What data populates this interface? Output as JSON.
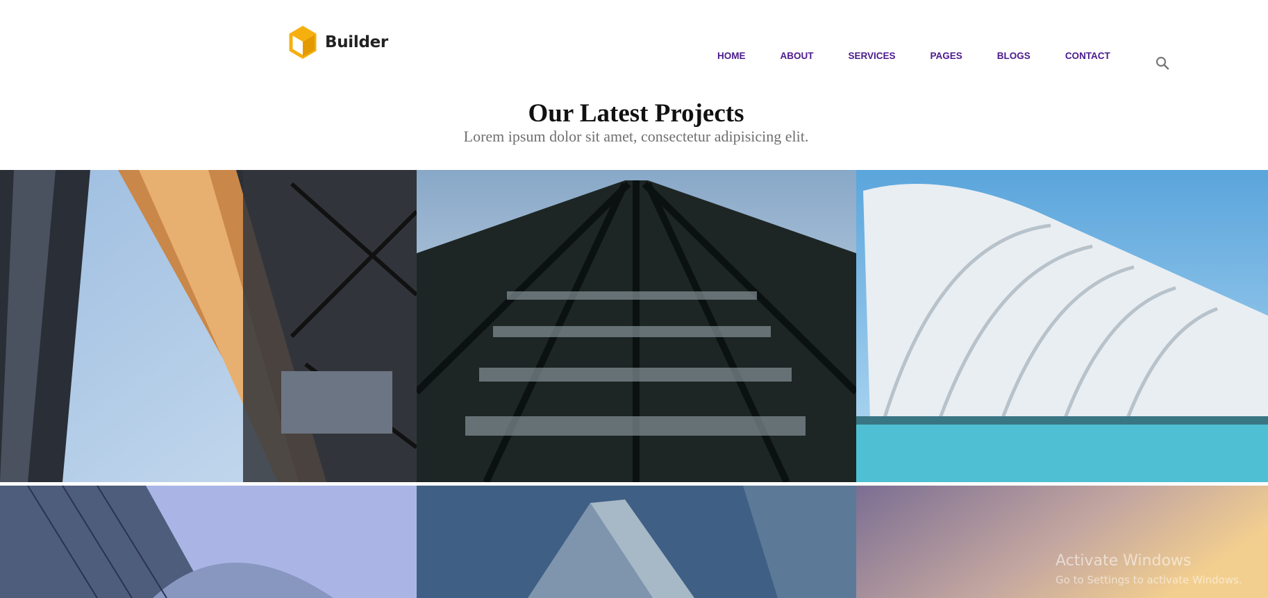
{
  "brand": {
    "name": "Builder",
    "accent": "#f5b010",
    "logo_icon": "cube-icon"
  },
  "nav": {
    "items": [
      "HOME",
      "ABOUT",
      "SERVICES",
      "PAGES",
      "BLOGS",
      "CONTACT"
    ],
    "color": "#4b1a8c"
  },
  "search": {
    "icon": "search-icon"
  },
  "section": {
    "title": "Our Latest Projects",
    "subtitle": "Lorem ipsum dolor sit amet, consectetur adipisicing elit."
  },
  "gallery": {
    "tiles": [
      "building-photo-steel-frame",
      "building-photo-black-tower",
      "building-photo-white-arches",
      "building-photo-glass-curve",
      "building-photo-glass-tower",
      "building-photo-sunset-sky"
    ]
  },
  "watermark": {
    "line1": "Activate Windows",
    "line2": "Go to Settings to activate Windows."
  }
}
